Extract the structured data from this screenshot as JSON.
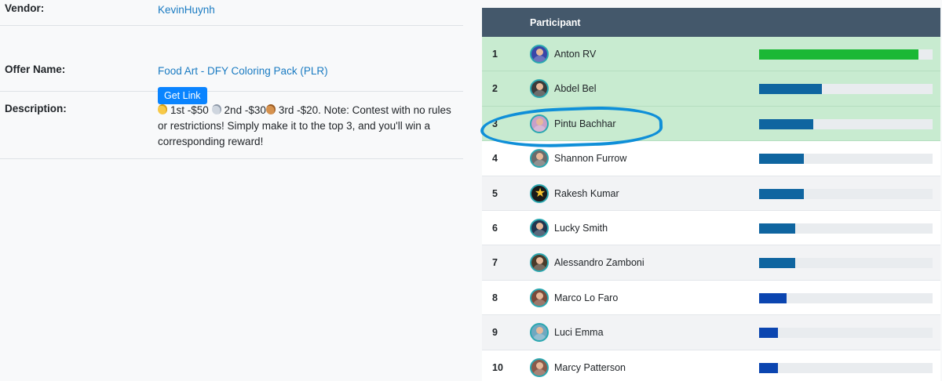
{
  "details": {
    "vendor": {
      "label": "Vendor:",
      "value": "KevinHuynh"
    },
    "offer": {
      "label": "Offer Name:",
      "value": "Food Art - DFY Coloring Pack (PLR)",
      "button": "Get Link"
    },
    "description": {
      "label": "Description:",
      "part1": "1st -$50",
      "part2": "2nd -$30",
      "part3": "3rd -$20. Note: Contest with no rules or restrictions! Simply make it to the top 3, and you'll win a corresponding reward!"
    }
  },
  "leaderboard": {
    "header": "Participant",
    "colors": {
      "top": "#1bb835",
      "normal": "#0f65a0",
      "low": "#0b45b0",
      "highlight_row": "#c8ebd0",
      "annotation": "#0f8fd8"
    },
    "rows": [
      {
        "rank": "1",
        "name": "Anton RV",
        "progress": 0.92,
        "avatar_color": "#3a46a8"
      },
      {
        "rank": "2",
        "name": "Abdel Bel",
        "progress": 0.36,
        "avatar_color": "#3b3b3b"
      },
      {
        "rank": "3",
        "name": "Pintu Bachhar",
        "progress": 0.31,
        "avatar_color": "#c8a0c8"
      },
      {
        "rank": "4",
        "name": "Shannon Furrow",
        "progress": 0.26,
        "avatar_color": "#6b6b6b"
      },
      {
        "rank": "5",
        "name": "Rakesh Kumar",
        "progress": 0.26,
        "avatar_color": "#1a1a1a",
        "icon": "star-icon"
      },
      {
        "rank": "6",
        "name": "Lucky Smith",
        "progress": 0.21,
        "avatar_color": "#22354f"
      },
      {
        "rank": "7",
        "name": "Alessandro Zamboni",
        "progress": 0.21,
        "avatar_color": "#4a3a2a"
      },
      {
        "rank": "8",
        "name": "Marco Lo Faro",
        "progress": 0.16,
        "avatar_color": "#7a4a3a"
      },
      {
        "rank": "9",
        "name": "Luci Emma",
        "progress": 0.11,
        "avatar_color": "#6fa8c0"
      },
      {
        "rank": "10",
        "name": "Marcy Patterson",
        "progress": 0.11,
        "avatar_color": "#8a5a4a"
      }
    ]
  }
}
